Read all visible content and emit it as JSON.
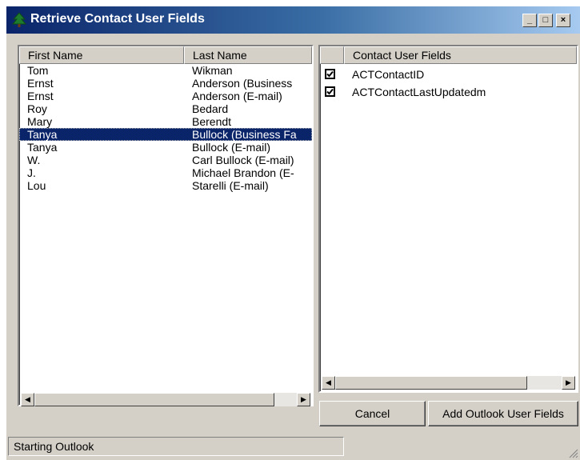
{
  "window": {
    "title": "Retrieve Contact User Fields"
  },
  "title_buttons": {
    "minimize": "_",
    "maximize": "□",
    "close": "×"
  },
  "contacts": {
    "columns": [
      "First Name",
      "Last Name"
    ],
    "rows": [
      {
        "first": "Tom",
        "last": "Wikman",
        "selected": false
      },
      {
        "first": "Ernst",
        "last": "Anderson (Business",
        "selected": false
      },
      {
        "first": "Ernst",
        "last": "Anderson (E-mail)",
        "selected": false
      },
      {
        "first": "Roy",
        "last": "Bedard",
        "selected": false
      },
      {
        "first": "Mary",
        "last": "Berendt",
        "selected": false
      },
      {
        "first": "Tanya",
        "last": "Bullock (Business Fa",
        "selected": true
      },
      {
        "first": "Tanya",
        "last": "Bullock (E-mail)",
        "selected": false
      },
      {
        "first": "W.",
        "last": "Carl Bullock (E-mail)",
        "selected": false
      },
      {
        "first": "J.",
        "last": "Michael Brandon (E-",
        "selected": false
      },
      {
        "first": "Lou",
        "last": "Starelli (E-mail)",
        "selected": false
      }
    ]
  },
  "user_fields": {
    "column": "Contact User Fields",
    "items": [
      {
        "label": "ACTContactID",
        "checked": true
      },
      {
        "label": "ACTContactLastUpdatedm",
        "checked": true
      }
    ]
  },
  "scroll_arrows": {
    "left": "◀",
    "right": "▶"
  },
  "buttons": {
    "cancel": "Cancel",
    "add": "Add Outlook User Fields"
  },
  "status": "Starting Outlook",
  "colors": {
    "title_start": "#0a246a",
    "title_end": "#a6caf0",
    "selection": "#0a246a",
    "face": "#d4d0c8"
  },
  "icons": {
    "app": "tree-icon",
    "checkbox": "checkmark-icon"
  }
}
